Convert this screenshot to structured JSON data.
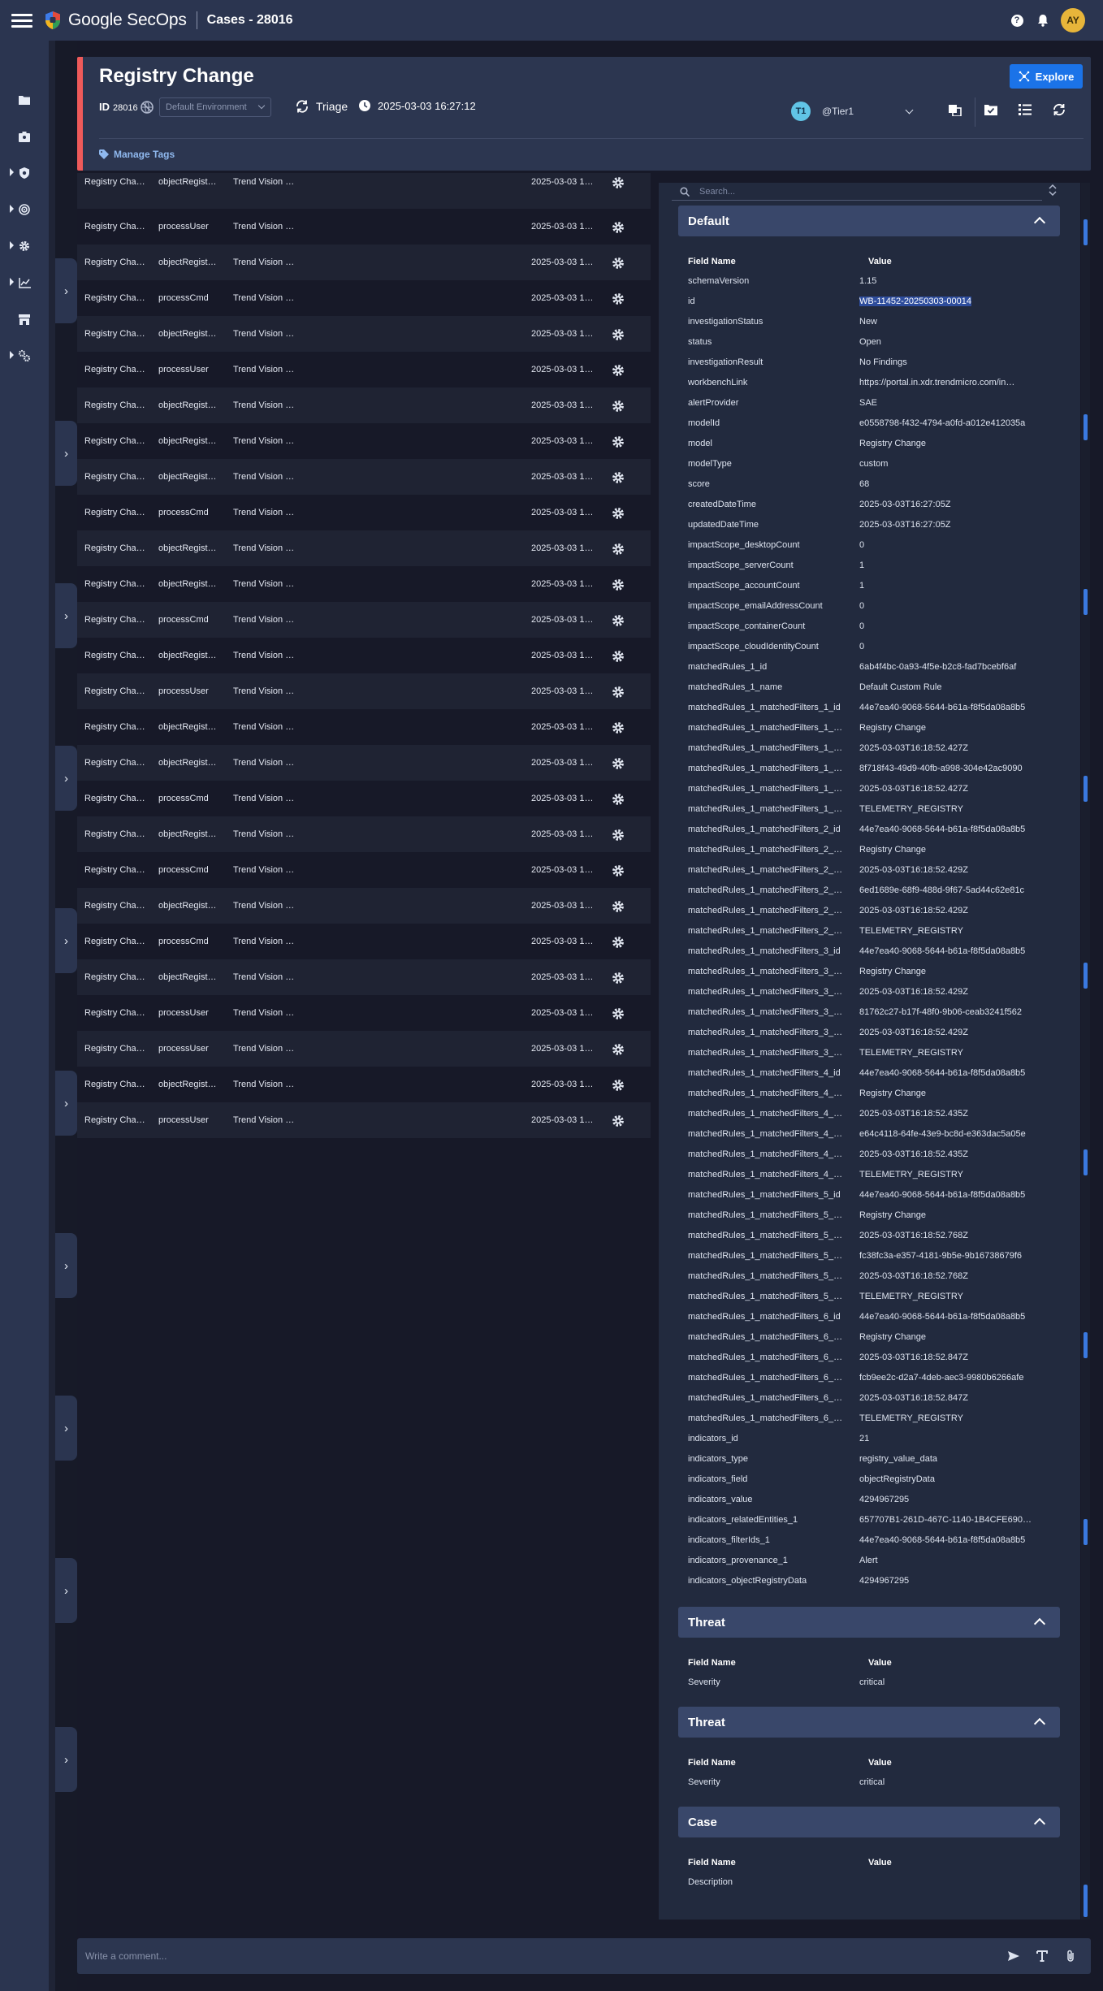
{
  "app": {
    "brand": "Google SecOps",
    "breadcrumb": "Cases - 28016",
    "user_initials": "AY",
    "help_icon": "help-icon",
    "bell_icon": "bell-icon"
  },
  "case": {
    "title": "Registry Change",
    "id_label": "ID",
    "id_value": "28016",
    "environment": "Default Environment",
    "stage": "Triage",
    "created": "2025-03-03 16:27:12",
    "explore_label": "Explore",
    "assignee_initials": "T1",
    "assignee": "@Tier1",
    "manage_tags": "Manage Tags",
    "accent_color": "#ee5a5a"
  },
  "events": {
    "rows": [
      {
        "name": "Registry Cha…",
        "type": "objectRegist…",
        "product": "Trend Vision …",
        "time": "2025-03-03 1…"
      },
      {
        "name": "Registry Cha…",
        "type": "processUser",
        "product": "Trend Vision …",
        "time": "2025-03-03 1…"
      },
      {
        "name": "Registry Cha…",
        "type": "objectRegist…",
        "product": "Trend Vision …",
        "time": "2025-03-03 1…"
      },
      {
        "name": "Registry Cha…",
        "type": "processCmd",
        "product": "Trend Vision …",
        "time": "2025-03-03 1…"
      },
      {
        "name": "Registry Cha…",
        "type": "objectRegist…",
        "product": "Trend Vision …",
        "time": "2025-03-03 1…"
      },
      {
        "name": "Registry Cha…",
        "type": "processUser",
        "product": "Trend Vision …",
        "time": "2025-03-03 1…"
      },
      {
        "name": "Registry Cha…",
        "type": "objectRegist…",
        "product": "Trend Vision …",
        "time": "2025-03-03 1…"
      },
      {
        "name": "Registry Cha…",
        "type": "objectRegist…",
        "product": "Trend Vision …",
        "time": "2025-03-03 1…"
      },
      {
        "name": "Registry Cha…",
        "type": "objectRegist…",
        "product": "Trend Vision …",
        "time": "2025-03-03 1…"
      },
      {
        "name": "Registry Cha…",
        "type": "processCmd",
        "product": "Trend Vision …",
        "time": "2025-03-03 1…"
      },
      {
        "name": "Registry Cha…",
        "type": "objectRegist…",
        "product": "Trend Vision …",
        "time": "2025-03-03 1…"
      },
      {
        "name": "Registry Cha…",
        "type": "objectRegist…",
        "product": "Trend Vision …",
        "time": "2025-03-03 1…"
      },
      {
        "name": "Registry Cha…",
        "type": "processCmd",
        "product": "Trend Vision …",
        "time": "2025-03-03 1…"
      },
      {
        "name": "Registry Cha…",
        "type": "objectRegist…",
        "product": "Trend Vision …",
        "time": "2025-03-03 1…"
      },
      {
        "name": "Registry Cha…",
        "type": "processUser",
        "product": "Trend Vision …",
        "time": "2025-03-03 1…"
      },
      {
        "name": "Registry Cha…",
        "type": "objectRegist…",
        "product": "Trend Vision …",
        "time": "2025-03-03 1…"
      },
      {
        "name": "Registry Cha…",
        "type": "objectRegist…",
        "product": "Trend Vision …",
        "time": "2025-03-03 1…"
      },
      {
        "name": "Registry Cha…",
        "type": "processCmd",
        "product": "Trend Vision …",
        "time": "2025-03-03 1…"
      },
      {
        "name": "Registry Cha…",
        "type": "objectRegist…",
        "product": "Trend Vision …",
        "time": "2025-03-03 1…"
      },
      {
        "name": "Registry Cha…",
        "type": "processCmd",
        "product": "Trend Vision …",
        "time": "2025-03-03 1…"
      },
      {
        "name": "Registry Cha…",
        "type": "objectRegist…",
        "product": "Trend Vision …",
        "time": "2025-03-03 1…"
      },
      {
        "name": "Registry Cha…",
        "type": "processCmd",
        "product": "Trend Vision …",
        "time": "2025-03-03 1…"
      },
      {
        "name": "Registry Cha…",
        "type": "objectRegist…",
        "product": "Trend Vision …",
        "time": "2025-03-03 1…"
      },
      {
        "name": "Registry Cha…",
        "type": "processUser",
        "product": "Trend Vision …",
        "time": "2025-03-03 1…"
      },
      {
        "name": "Registry Cha…",
        "type": "processUser",
        "product": "Trend Vision …",
        "time": "2025-03-03 1…"
      },
      {
        "name": "Registry Cha…",
        "type": "objectRegist…",
        "product": "Trend Vision …",
        "time": "2025-03-03 1…"
      },
      {
        "name": "Registry Cha…",
        "type": "processUser",
        "product": "Trend Vision …",
        "time": "2025-03-03 1…"
      }
    ]
  },
  "details": {
    "search_placeholder": "Search...",
    "field_name_header": "Field Name",
    "value_header": "Value",
    "sections": [
      {
        "title": "Default",
        "rows": [
          {
            "name": "schemaVersion",
            "value": "1.15"
          },
          {
            "name": "id",
            "value": "WB-11452-20250303-00014"
          },
          {
            "name": "investigationStatus",
            "value": "New"
          },
          {
            "name": "status",
            "value": "Open"
          },
          {
            "name": "investigationResult",
            "value": "No Findings"
          },
          {
            "name": "workbenchLink",
            "value": "https://portal.in.xdr.trendmicro.com/in…"
          },
          {
            "name": "alertProvider",
            "value": "SAE"
          },
          {
            "name": "modelId",
            "value": "e0558798-f432-4794-a0fd-a012e412035a"
          },
          {
            "name": "model",
            "value": "Registry Change"
          },
          {
            "name": "modelType",
            "value": "custom"
          },
          {
            "name": "score",
            "value": "68"
          },
          {
            "name": "createdDateTime",
            "value": "2025-03-03T16:27:05Z"
          },
          {
            "name": "updatedDateTime",
            "value": "2025-03-03T16:27:05Z"
          },
          {
            "name": "impactScope_desktopCount",
            "value": "0"
          },
          {
            "name": "impactScope_serverCount",
            "value": "1"
          },
          {
            "name": "impactScope_accountCount",
            "value": "1"
          },
          {
            "name": "impactScope_emailAddressCount",
            "value": "0"
          },
          {
            "name": "impactScope_containerCount",
            "value": "0"
          },
          {
            "name": "impactScope_cloudIdentityCount",
            "value": "0"
          },
          {
            "name": "matchedRules_1_id",
            "value": "6ab4f4bc-0a93-4f5e-b2c8-fad7bcebf6af"
          },
          {
            "name": "matchedRules_1_name",
            "value": "Default Custom Rule"
          },
          {
            "name": "matchedRules_1_matchedFilters_1_id",
            "value": "44e7ea40-9068-5644-b61a-f8f5da08a8b5"
          },
          {
            "name": "matchedRules_1_matchedFilters_1_…",
            "value": "Registry Change"
          },
          {
            "name": "matchedRules_1_matchedFilters_1_…",
            "value": "2025-03-03T16:18:52.427Z"
          },
          {
            "name": "matchedRules_1_matchedFilters_1_…",
            "value": "8f718f43-49d9-40fb-a998-304e42ac9090"
          },
          {
            "name": "matchedRules_1_matchedFilters_1_…",
            "value": "2025-03-03T16:18:52.427Z"
          },
          {
            "name": "matchedRules_1_matchedFilters_1_…",
            "value": "TELEMETRY_REGISTRY"
          },
          {
            "name": "matchedRules_1_matchedFilters_2_id",
            "value": "44e7ea40-9068-5644-b61a-f8f5da08a8b5"
          },
          {
            "name": "matchedRules_1_matchedFilters_2_…",
            "value": "Registry Change"
          },
          {
            "name": "matchedRules_1_matchedFilters_2_…",
            "value": "2025-03-03T16:18:52.429Z"
          },
          {
            "name": "matchedRules_1_matchedFilters_2_…",
            "value": "6ed1689e-68f9-488d-9f67-5ad44c62e81c"
          },
          {
            "name": "matchedRules_1_matchedFilters_2_…",
            "value": "2025-03-03T16:18:52.429Z"
          },
          {
            "name": "matchedRules_1_matchedFilters_2_…",
            "value": "TELEMETRY_REGISTRY"
          },
          {
            "name": "matchedRules_1_matchedFilters_3_id",
            "value": "44e7ea40-9068-5644-b61a-f8f5da08a8b5"
          },
          {
            "name": "matchedRules_1_matchedFilters_3_…",
            "value": "Registry Change"
          },
          {
            "name": "matchedRules_1_matchedFilters_3_…",
            "value": "2025-03-03T16:18:52.429Z"
          },
          {
            "name": "matchedRules_1_matchedFilters_3_…",
            "value": "81762c27-b17f-48f0-9b06-ceab3241f562"
          },
          {
            "name": "matchedRules_1_matchedFilters_3_…",
            "value": "2025-03-03T16:18:52.429Z"
          },
          {
            "name": "matchedRules_1_matchedFilters_3_…",
            "value": "TELEMETRY_REGISTRY"
          },
          {
            "name": "matchedRules_1_matchedFilters_4_id",
            "value": "44e7ea40-9068-5644-b61a-f8f5da08a8b5"
          },
          {
            "name": "matchedRules_1_matchedFilters_4_…",
            "value": "Registry Change"
          },
          {
            "name": "matchedRules_1_matchedFilters_4_…",
            "value": "2025-03-03T16:18:52.435Z"
          },
          {
            "name": "matchedRules_1_matchedFilters_4_…",
            "value": "e64c4118-64fe-43e9-bc8d-e363dac5a05e"
          },
          {
            "name": "matchedRules_1_matchedFilters_4_…",
            "value": "2025-03-03T16:18:52.435Z"
          },
          {
            "name": "matchedRules_1_matchedFilters_4_…",
            "value": "TELEMETRY_REGISTRY"
          },
          {
            "name": "matchedRules_1_matchedFilters_5_id",
            "value": "44e7ea40-9068-5644-b61a-f8f5da08a8b5"
          },
          {
            "name": "matchedRules_1_matchedFilters_5_…",
            "value": "Registry Change"
          },
          {
            "name": "matchedRules_1_matchedFilters_5_…",
            "value": "2025-03-03T16:18:52.768Z"
          },
          {
            "name": "matchedRules_1_matchedFilters_5_…",
            "value": "fc38fc3a-e357-4181-9b5e-9b16738679f6"
          },
          {
            "name": "matchedRules_1_matchedFilters_5_…",
            "value": "2025-03-03T16:18:52.768Z"
          },
          {
            "name": "matchedRules_1_matchedFilters_5_…",
            "value": "TELEMETRY_REGISTRY"
          },
          {
            "name": "matchedRules_1_matchedFilters_6_id",
            "value": "44e7ea40-9068-5644-b61a-f8f5da08a8b5"
          },
          {
            "name": "matchedRules_1_matchedFilters_6_…",
            "value": "Registry Change"
          },
          {
            "name": "matchedRules_1_matchedFilters_6_…",
            "value": "2025-03-03T16:18:52.847Z"
          },
          {
            "name": "matchedRules_1_matchedFilters_6_…",
            "value": "fcb9ee2c-d2a7-4deb-aec3-9980b6266afe"
          },
          {
            "name": "matchedRules_1_matchedFilters_6_…",
            "value": "2025-03-03T16:18:52.847Z"
          },
          {
            "name": "matchedRules_1_matchedFilters_6_…",
            "value": "TELEMETRY_REGISTRY"
          },
          {
            "name": "indicators_id",
            "value": "21"
          },
          {
            "name": "indicators_type",
            "value": "registry_value_data"
          },
          {
            "name": "indicators_field",
            "value": "objectRegistryData"
          },
          {
            "name": "indicators_value",
            "value": "4294967295"
          },
          {
            "name": "indicators_relatedEntities_1",
            "value": "657707B1-261D-467C-1140-1B4CFE690…"
          },
          {
            "name": "indicators_filterIds_1",
            "value": "44e7ea40-9068-5644-b61a-f8f5da08a8b5"
          },
          {
            "name": "indicators_provenance_1",
            "value": "Alert"
          },
          {
            "name": "indicators_objectRegistryData",
            "value": "4294967295"
          }
        ]
      },
      {
        "title": "Threat",
        "rows": [
          {
            "name": "Severity",
            "value": "critical"
          }
        ]
      },
      {
        "title": "Threat",
        "rows": [
          {
            "name": "Severity",
            "value": "critical"
          }
        ]
      },
      {
        "title": "Case",
        "rows": [
          {
            "name": "Description",
            "value": ""
          }
        ]
      }
    ]
  },
  "comment": {
    "placeholder": "Write a comment..."
  }
}
